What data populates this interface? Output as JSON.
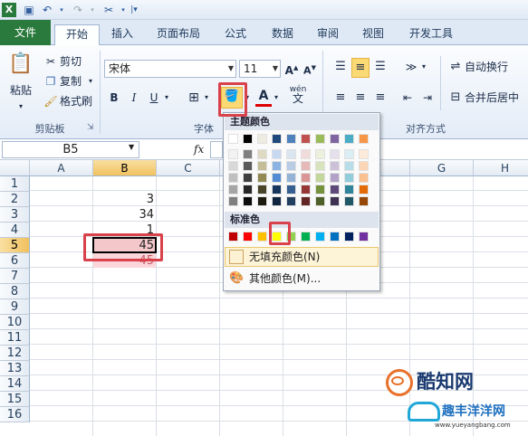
{
  "ribbon_tabs": [
    "文件",
    "开始",
    "插入",
    "页面布局",
    "公式",
    "数据",
    "审阅",
    "视图",
    "开发工具"
  ],
  "clipboard": {
    "paste": "粘贴",
    "cut": "剪切",
    "copy": "复制",
    "format_painter": "格式刷",
    "group_label": "剪贴板"
  },
  "font": {
    "name": "宋体",
    "size": "11",
    "bold": "B",
    "italic": "I",
    "underline": "U",
    "group_label": "字体",
    "wen": "wén"
  },
  "alignment": {
    "wrap": "自动换行",
    "merge": "合并后居中",
    "group_label": "对齐方式"
  },
  "formula_bar": {
    "name_box": "B5",
    "fx": "fx"
  },
  "columns": [
    "A",
    "B",
    "C",
    "D",
    "E",
    "F",
    "G",
    "H"
  ],
  "rows": [
    "1",
    "2",
    "3",
    "4",
    "5",
    "6",
    "7",
    "8",
    "9",
    "10",
    "11",
    "12",
    "13",
    "14",
    "15",
    "16"
  ],
  "cells": {
    "B2": "3",
    "B3": "34",
    "B4": "1",
    "B5": "45",
    "B6": "45"
  },
  "fill_menu": {
    "theme_colors_label": "主题颜色",
    "standard_colors_label": "标准色",
    "no_fill": "无填充颜色(N)",
    "more_colors": "其他颜色(M)...",
    "theme_top": [
      "#ffffff",
      "#000000",
      "#eeece1",
      "#1f497d",
      "#4f81bd",
      "#c0504d",
      "#9bbb59",
      "#8064a2",
      "#4bacc6",
      "#f79646"
    ],
    "theme_shades": [
      [
        "#f2f2f2",
        "#7f7f7f",
        "#ddd9c3",
        "#c6d9f0",
        "#dbe5f1",
        "#f2dcdb",
        "#ebf1dd",
        "#e5e0ec",
        "#dbeef3",
        "#fdeada"
      ],
      [
        "#d8d8d8",
        "#595959",
        "#c4bd97",
        "#8db3e2",
        "#b8cce4",
        "#e5b9b7",
        "#d7e3bc",
        "#ccc1d9",
        "#b7dde8",
        "#fbd5b5"
      ],
      [
        "#bfbfbf",
        "#3f3f3f",
        "#938953",
        "#548dd4",
        "#95b3d7",
        "#d99694",
        "#c3d69b",
        "#b2a2c7",
        "#92cddc",
        "#fac08f"
      ],
      [
        "#a5a5a5",
        "#262626",
        "#494429",
        "#17365d",
        "#366092",
        "#953734",
        "#76923c",
        "#5f497a",
        "#31859b",
        "#e36c09"
      ],
      [
        "#7f7f7f",
        "#0c0c0c",
        "#1d1b10",
        "#0f243e",
        "#244061",
        "#632423",
        "#4f6128",
        "#3f3151",
        "#205867",
        "#974806"
      ]
    ],
    "standard": [
      "#c00000",
      "#ff0000",
      "#ffc000",
      "#ffff00",
      "#92d050",
      "#00b050",
      "#00b0f0",
      "#0070c0",
      "#002060",
      "#7030a0"
    ]
  },
  "watermark": {
    "brand": "酷知网",
    "sub": "趣丰洋洋网",
    "url": "www.yueyangbang.com"
  }
}
